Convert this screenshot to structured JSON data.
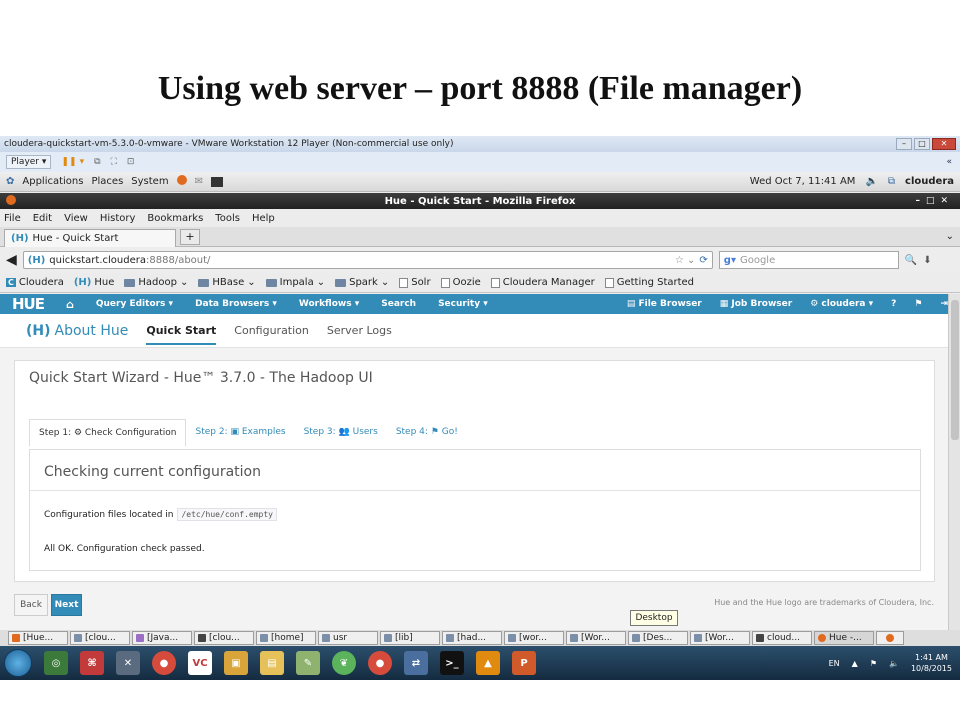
{
  "slide": {
    "title": "Using web server – port 8888 (File manager)"
  },
  "vm": {
    "window_title": "cloudera-quickstart-vm-5.3.0-0-vmware - VMware Workstation 12 Player (Non-commercial use only)",
    "player_label": "Player"
  },
  "gnome": {
    "applications": "Applications",
    "places": "Places",
    "system": "System",
    "datetime": "Wed Oct  7, 11:41 AM",
    "user": "cloudera"
  },
  "firefox": {
    "title": "Hue - Quick Start - Mozilla Firefox",
    "menu": [
      "File",
      "Edit",
      "View",
      "History",
      "Bookmarks",
      "Tools",
      "Help"
    ],
    "tab_title": "Hue - Quick Start",
    "url_host": "quickstart.cloudera",
    "url_path": ":8888/about/",
    "search_placeholder": "Google",
    "bookmarks": [
      "Cloudera",
      "Hue",
      "Hadoop",
      "HBase",
      "Impala",
      "Spark",
      "Solr",
      "Oozie",
      "Cloudera Manager",
      "Getting Started"
    ]
  },
  "hue": {
    "logo": "HUE",
    "nav": [
      "Query Editors ▾",
      "Data Browsers ▾",
      "Workflows ▾",
      "Search",
      "Security ▾"
    ],
    "nav_right": [
      "File Browser",
      "Job Browser",
      "cloudera ▾"
    ],
    "sub_brand": "About Hue",
    "sub_tabs": [
      "Quick Start",
      "Configuration",
      "Server Logs"
    ],
    "wizard_title": "Quick Start Wizard - Hue™ 3.7.0 - The Hadoop UI",
    "steps": [
      "Step 1: ⚙ Check Configuration",
      "Step 2: ▣ Examples",
      "Step 3: 👥 Users",
      "Step 4: ⚑ Go!"
    ],
    "panel_heading": "Checking current configuration",
    "config_text": "Configuration files located in",
    "config_path": "/etc/hue/conf.empty",
    "status": "All OK. Configuration check passed.",
    "back": "Back",
    "next": "Next",
    "trademark": "Hue and the Hue logo are trademarks of Cloudera, Inc."
  },
  "tooltip": "Desktop",
  "windows": [
    "[Hue...",
    "[clou...",
    "[Java...",
    "[clou...",
    "[home]",
    "usr",
    "[lib]",
    "[had...",
    "[wor...",
    "[Wor...",
    "[Des...",
    "[Wor...",
    "cloud...",
    "Hue -..."
  ],
  "tray": {
    "lang": "EN",
    "time": "1:41 AM",
    "date": "10/8/2015"
  },
  "colors": {
    "hue_blue": "#338bb8"
  }
}
